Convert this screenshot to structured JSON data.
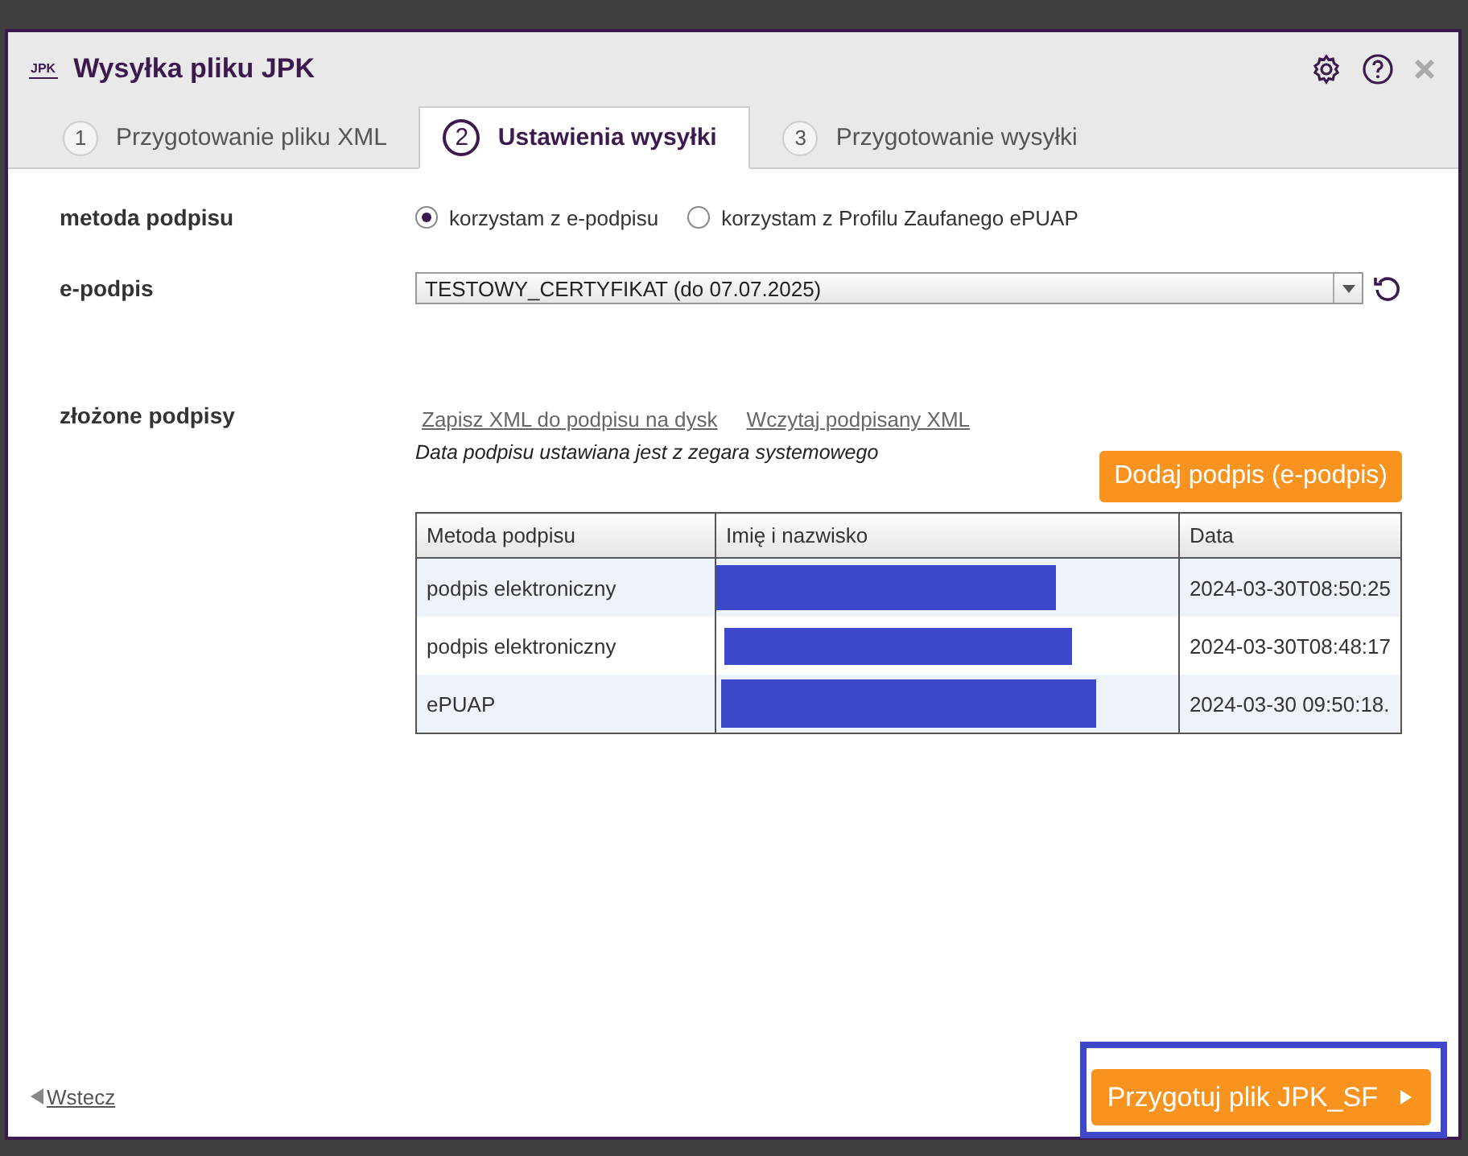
{
  "dialog": {
    "logo": "JPK",
    "title": "Wysyłka pliku JPK"
  },
  "tabs": [
    {
      "number": "1",
      "label": "Przygotowanie pliku XML",
      "selected": false
    },
    {
      "number": "2",
      "label": "Ustawienia wysyłki",
      "selected": true
    },
    {
      "number": "3",
      "label": "Przygotowanie wysyłki",
      "selected": false
    }
  ],
  "signature_method": {
    "label": "metoda podpisu",
    "options": [
      {
        "label": "korzystam z e-podpisu",
        "selected": true
      },
      {
        "label": "korzystam z Profilu Zaufanego ePUAP",
        "selected": false
      }
    ]
  },
  "e_signature": {
    "label": "e-podpis",
    "value": "TESTOWY_CERTYFIKAT (do 07.07.2025)"
  },
  "signatures": {
    "label": "złożone podpisy",
    "links": [
      "Zapisz XML do podpisu na dysk",
      "Wczytaj podpisany XML"
    ],
    "note": "Data podpisu ustawiana jest z zegara systemowego",
    "add_button": "Dodaj podpis (e-podpis)",
    "table": {
      "columns": [
        "Metoda podpisu",
        "Imię i nazwisko",
        "Data"
      ],
      "rows": [
        {
          "method": "podpis elektroniczny",
          "date": "2024-03-30T08:50:25"
        },
        {
          "method": "podpis elektroniczny",
          "date": "2024-03-30T08:48:17"
        },
        {
          "method": "ePUAP",
          "date": "2024-03-30 09:50:18."
        }
      ]
    }
  },
  "footer": {
    "back": "Wstecz",
    "next": "Przygotuj plik JPK_SF"
  }
}
